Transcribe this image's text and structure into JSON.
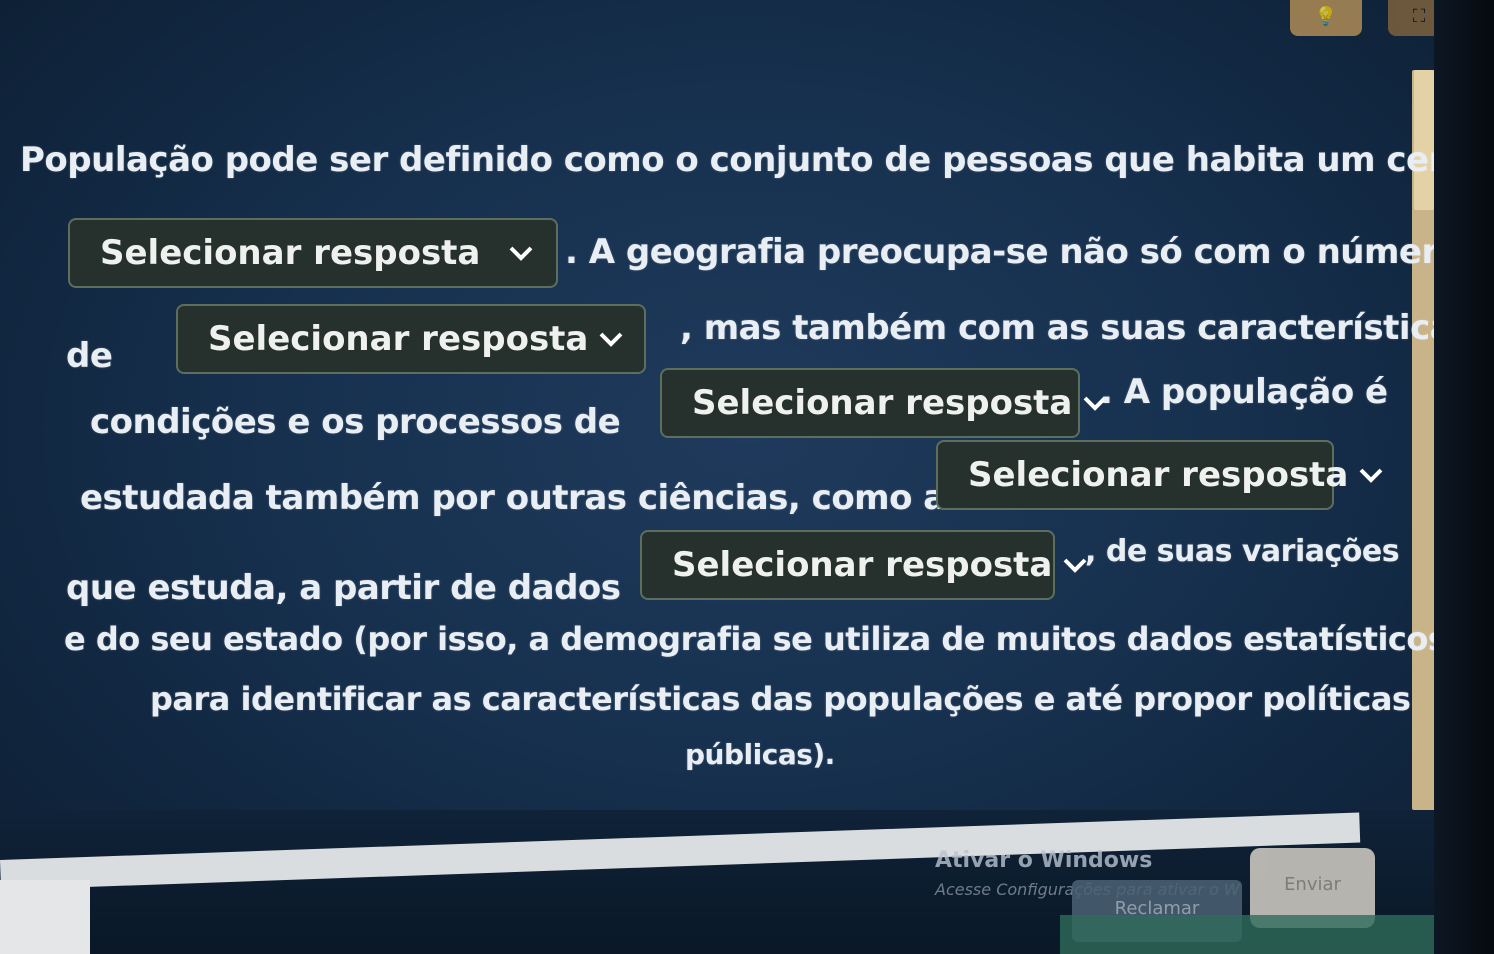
{
  "top_buttons": [
    {
      "icon": "lightbulb-icon",
      "glyph": "💡"
    },
    {
      "icon": "expand-icon",
      "glyph": "⛶"
    }
  ],
  "question": {
    "line1": "População pode ser definido como o conjunto de pessoas que habita um certo",
    "after_dd1": ". A geografia preocupa-se não só com o número",
    "before_dd2": "de",
    "after_dd2": ", mas também com as suas características,",
    "before_dd3": "condições e os processos de",
    "after_dd3": ". A população é",
    "before_dd4": "estudada também por outras ciências, como a",
    "before_dd5": "que estuda, a partir de dados",
    "after_dd5": ", de suas variações",
    "line7": "e do seu estado (por isso, a demografia se utiliza de muitos dados estatísticos",
    "line8": "para identificar as características das populações e até propor políticas",
    "line9": "públicas)."
  },
  "dropdowns": [
    {
      "label": "Selecionar resposta"
    },
    {
      "label": "Selecionar resposta"
    },
    {
      "label": "Selecionar resposta"
    },
    {
      "label": "Selecionar resposta"
    },
    {
      "label": "Selecionar resposta"
    }
  ],
  "watermark": {
    "title": "Ativar o Windows",
    "subtitle": "Acesse Configurações para ativar o W"
  },
  "buttons": {
    "reclaim": "Reclamar",
    "send": "Enviar"
  }
}
